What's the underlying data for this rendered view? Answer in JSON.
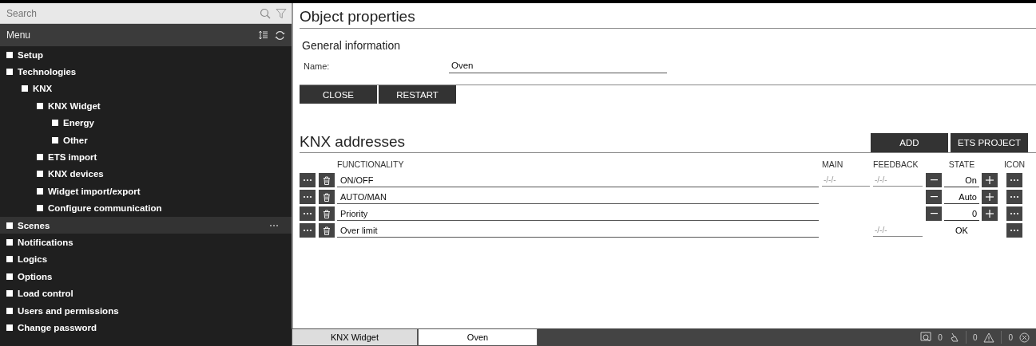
{
  "sidebar": {
    "search": {
      "placeholder": "Search"
    },
    "menu_title": "Menu",
    "items": [
      {
        "label": "Setup",
        "selected": false
      },
      {
        "label": "Technologies",
        "selected": false,
        "children": [
          {
            "label": "KNX",
            "selected": false,
            "children": [
              {
                "label": "KNX Widget",
                "selected": false,
                "children": [
                  {
                    "label": "Energy",
                    "selected": false
                  },
                  {
                    "label": "Other",
                    "selected": false
                  }
                ]
              },
              {
                "label": "ETS import",
                "selected": false
              },
              {
                "label": "KNX devices",
                "selected": false
              },
              {
                "label": "Widget import/export",
                "selected": false
              },
              {
                "label": "Configure communication",
                "selected": false
              }
            ]
          }
        ]
      },
      {
        "label": "Scenes",
        "selected": true
      },
      {
        "label": "Notifications",
        "selected": false
      },
      {
        "label": "Logics",
        "selected": false
      },
      {
        "label": "Options",
        "selected": false
      },
      {
        "label": "Load control",
        "selected": false
      },
      {
        "label": "Users and permissions",
        "selected": false
      },
      {
        "label": "Change password",
        "selected": false
      }
    ]
  },
  "object_properties": {
    "title": "Object properties",
    "section": "General information",
    "name_label": "Name:",
    "name_value": "Oven",
    "buttons": [
      "CLOSE",
      "RESTART"
    ]
  },
  "knx_addresses": {
    "title": "KNX addresses",
    "buttons": [
      "ADD",
      "ETS PROJECT"
    ],
    "columns": [
      "FUNCTIONALITY",
      "MAIN",
      "FEEDBACK",
      "STATE",
      "ICON"
    ],
    "rows": [
      {
        "functionality": "ON/OFF",
        "main": {
          "placeholder": "-/-/-"
        },
        "feedback": {
          "placeholder": "-/-/-"
        },
        "state": {
          "kind": "stepper",
          "value": "On"
        }
      },
      {
        "functionality": "AUTO/MAN",
        "state": {
          "kind": "stepper",
          "value": "Auto"
        }
      },
      {
        "functionality": "Priority",
        "state": {
          "kind": "stepper",
          "value": "0"
        }
      },
      {
        "functionality": "Over limit",
        "feedback": {
          "placeholder": "-/-/-"
        },
        "state": {
          "kind": "text",
          "value": "OK"
        }
      }
    ]
  },
  "bottom_tabs": [
    {
      "label": "KNX Widget",
      "selected": false
    },
    {
      "label": "Oven",
      "selected": true
    }
  ],
  "status_bar": {
    "counts": [
      "0",
      "0",
      "0"
    ]
  }
}
